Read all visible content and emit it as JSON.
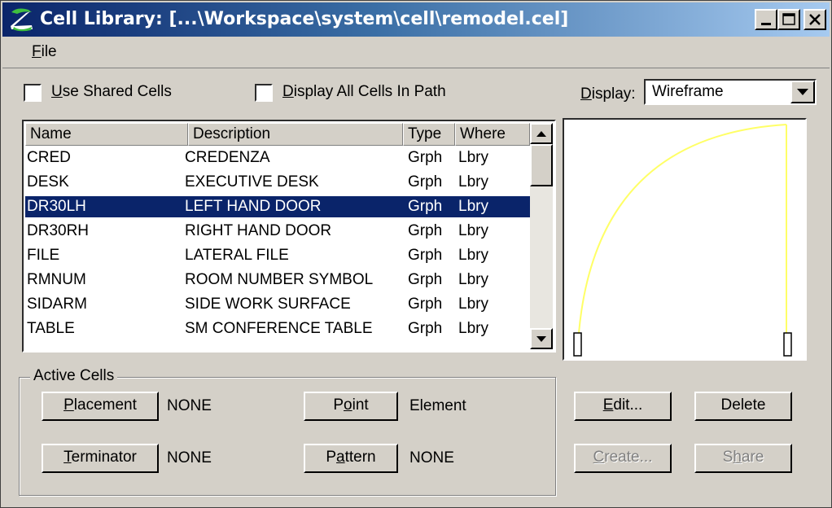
{
  "window": {
    "title": "Cell Library: [...\\Workspace\\system\\cell\\remodel.cel]"
  },
  "menu": {
    "file_prefix": "F",
    "file_rest": "ile"
  },
  "options": {
    "use_shared": {
      "u": "U",
      "rest": "se Shared Cells",
      "checked": false
    },
    "display_all": {
      "u": "D",
      "rest": "isplay All Cells In Path",
      "checked": false
    }
  },
  "display": {
    "label_u": "D",
    "label_rest": "isplay:",
    "value": "Wireframe"
  },
  "list": {
    "headers": {
      "name": "Name",
      "description": "Description",
      "type": "Type",
      "where": "Where"
    },
    "rows": [
      {
        "name": "CRED",
        "description": "CREDENZA",
        "type": "Grph",
        "where": "Lbry"
      },
      {
        "name": "DESK",
        "description": "EXECUTIVE DESK",
        "type": "Grph",
        "where": "Lbry"
      },
      {
        "name": "DR30LH",
        "description": "LEFT HAND DOOR",
        "type": "Grph",
        "where": "Lbry"
      },
      {
        "name": "DR30RH",
        "description": "RIGHT HAND DOOR",
        "type": "Grph",
        "where": "Lbry"
      },
      {
        "name": "FILE",
        "description": "LATERAL FILE",
        "type": "Grph",
        "where": "Lbry"
      },
      {
        "name": "RMNUM",
        "description": "ROOM NUMBER SYMBOL",
        "type": "Grph",
        "where": "Lbry"
      },
      {
        "name": "SIDARM",
        "description": "SIDE WORK SURFACE",
        "type": "Grph",
        "where": "Lbry"
      },
      {
        "name": "TABLE",
        "description": "SM CONFERENCE TABLE",
        "type": "Grph",
        "where": "Lbry"
      }
    ],
    "selected_index": 2
  },
  "active_cells": {
    "title": "Active Cells",
    "placement": {
      "pre": "",
      "u": "P",
      "post": "lacement",
      "value": "NONE"
    },
    "terminator": {
      "pre": "",
      "u": "T",
      "post": "erminator",
      "value": "NONE"
    },
    "point": {
      "pre": "P",
      "u": "o",
      "post": "int",
      "value": "Element"
    },
    "pattern": {
      "pre": "P",
      "u": "a",
      "post": "ttern",
      "value": "NONE"
    }
  },
  "actions": {
    "edit": {
      "u": "E",
      "rest": "dit..."
    },
    "delete": {
      "label": "Delete"
    },
    "create": {
      "u": "C",
      "rest": "reate..."
    },
    "share": {
      "pre": "S",
      "u": "h",
      "post": "are"
    }
  },
  "colors": {
    "preview_stroke": "#ffff66",
    "selection": "#0a246a",
    "title_start": "#0a246a"
  },
  "icons": [
    "app-logo-icon",
    "minimize-icon",
    "maximize-icon",
    "close-icon",
    "dropdown-arrow-icon",
    "scroll-up-icon",
    "scroll-down-icon"
  ]
}
